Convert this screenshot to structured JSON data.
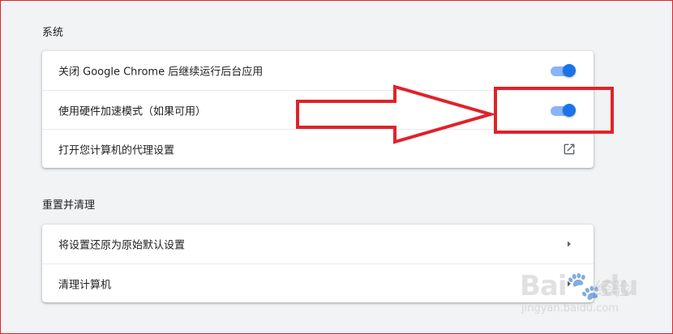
{
  "colors": {
    "accent": "#1a73e8",
    "track": "#8ab4f8",
    "annotation": "#e0222a",
    "background": "#f1f3f4"
  },
  "system": {
    "title": "系统",
    "rows": [
      {
        "label": "关闭 Google Chrome 后继续运行后台应用",
        "control": "toggle",
        "state": "on"
      },
      {
        "label": "使用硬件加速模式（如果可用）",
        "control": "toggle",
        "state": "on"
      },
      {
        "label": "打开您计算机的代理设置",
        "control": "open-in-new-icon"
      }
    ]
  },
  "reset": {
    "title": "重置并清理",
    "rows": [
      {
        "label": "将设置还原为原始默认设置",
        "control": "chevron-right-icon"
      },
      {
        "label": "清理计算机",
        "control": "chevron-right-icon"
      }
    ]
  },
  "watermark": {
    "brand": "Bai",
    "brand2": "du",
    "suffix": "经验",
    "url": "jingyan.baidu.com"
  }
}
